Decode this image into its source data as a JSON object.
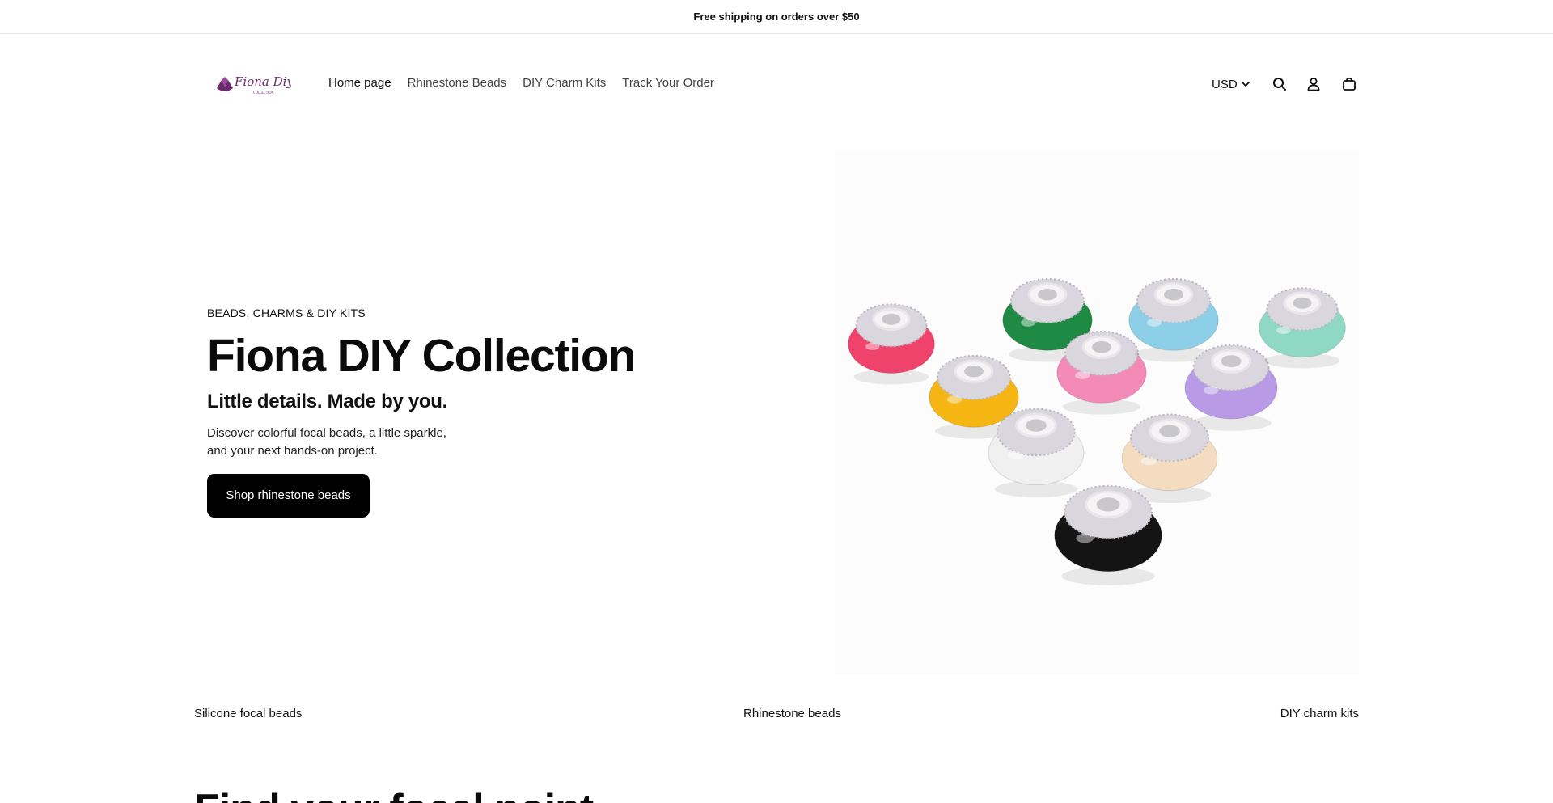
{
  "announcement": {
    "text": "Free shipping on orders over $50"
  },
  "header": {
    "logo_text": "Fiona Diy",
    "logo_subtext": "COLLECTION",
    "nav": [
      {
        "label": "Home page",
        "active": true
      },
      {
        "label": "Rhinestone Beads",
        "active": false
      },
      {
        "label": "DIY Charm Kits",
        "active": false
      },
      {
        "label": "Track Your Order",
        "active": false
      }
    ],
    "currency": "USD",
    "icons": [
      "chevron-down-icon",
      "search-icon",
      "account-icon",
      "cart-icon"
    ]
  },
  "hero": {
    "eyebrow": "BEADS, CHARMS & DIY KITS",
    "title": "Fiona DIY Collection",
    "subtitle": "Little details. Made by you.",
    "description": "Discover colorful focal beads, a little sparkle, and your next hands-on project.",
    "cta_label": "Shop rhinestone beads",
    "bead_colors": [
      "#f0436c",
      "#f5b512",
      "#1f8a44",
      "#f48ab8",
      "#8ccfe6",
      "#b89ae6",
      "#8fd9c4",
      "#f0f0f0",
      "#f3dcc0",
      "#141414"
    ]
  },
  "categories": [
    {
      "label": "Silicone focal beads"
    },
    {
      "label": "Rhinestone beads"
    },
    {
      "label": "DIY charm kits"
    }
  ],
  "next_section": {
    "heading": "Find your focal point"
  },
  "colors": {
    "accent": "#000000",
    "border": "#e6e6e6",
    "logo_purple": "#6b2a6e"
  }
}
